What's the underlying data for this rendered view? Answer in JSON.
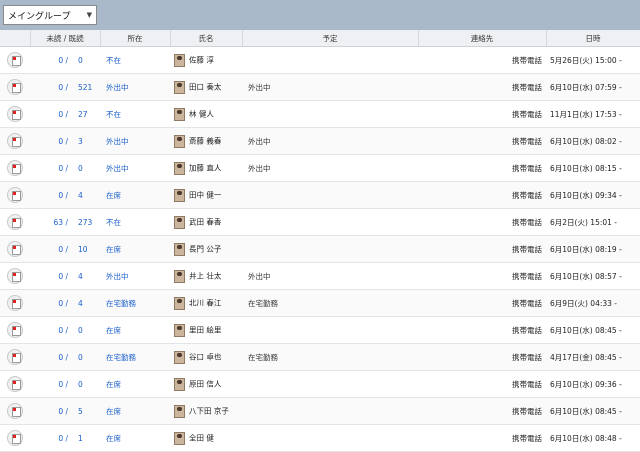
{
  "group_select": {
    "value": "メイングループ"
  },
  "headers": {
    "unread_read": "未読 / 既読",
    "location": "所在",
    "name": "氏名",
    "schedule": "予定",
    "contact": "連絡先",
    "datetime": "日時"
  },
  "rows": [
    {
      "unread": "0 /",
      "read": "0",
      "status": "不在",
      "name": "佐藤 淳",
      "schedule": "",
      "contact": "携帯電話",
      "datetime": "5月26日(火) 15:00 -"
    },
    {
      "unread": "0 /",
      "read": "521",
      "status": "外出中",
      "name": "田口 奏太",
      "schedule": "外出中",
      "contact": "携帯電話",
      "datetime": "6月10日(水) 07:59 -"
    },
    {
      "unread": "0 /",
      "read": "27",
      "status": "不在",
      "name": "林 健人",
      "schedule": "",
      "contact": "携帯電話",
      "datetime": "11月1日(水) 17:53 -"
    },
    {
      "unread": "0 /",
      "read": "3",
      "status": "外出中",
      "name": "斎藤 義春",
      "schedule": "外出中",
      "contact": "携帯電話",
      "datetime": "6月10日(水) 08:02 -"
    },
    {
      "unread": "0 /",
      "read": "0",
      "status": "外出中",
      "name": "加藤 直人",
      "schedule": "外出中",
      "contact": "携帯電話",
      "datetime": "6月10日(水) 08:15 -"
    },
    {
      "unread": "0 /",
      "read": "4",
      "status": "在席",
      "name": "田中 健一",
      "schedule": "",
      "contact": "携帯電話",
      "datetime": "6月10日(水) 09:34 -"
    },
    {
      "unread": "63 /",
      "read": "273",
      "status": "不在",
      "name": "武田 春香",
      "schedule": "",
      "contact": "携帯電話",
      "datetime": "6月2日(火) 15:01 -"
    },
    {
      "unread": "0 /",
      "read": "10",
      "status": "在席",
      "name": "長門 公子",
      "schedule": "",
      "contact": "携帯電話",
      "datetime": "6月10日(水) 08:19 -"
    },
    {
      "unread": "0 /",
      "read": "4",
      "status": "外出中",
      "name": "井上 壮太",
      "schedule": "外出中",
      "contact": "携帯電話",
      "datetime": "6月10日(水) 08:57 -"
    },
    {
      "unread": "0 /",
      "read": "4",
      "status": "在宅勤務",
      "name": "北川 春江",
      "schedule": "在宅勤務",
      "contact": "携帯電話",
      "datetime": "6月9日(火) 04:33 -"
    },
    {
      "unread": "0 /",
      "read": "0",
      "status": "在席",
      "name": "里田 絵里",
      "schedule": "",
      "contact": "携帯電話",
      "datetime": "6月10日(水) 08:45 -"
    },
    {
      "unread": "0 /",
      "read": "0",
      "status": "在宅勤務",
      "name": "谷口 卓也",
      "schedule": "在宅勤務",
      "contact": "携帯電話",
      "datetime": "4月17日(金) 08:45 -"
    },
    {
      "unread": "0 /",
      "read": "0",
      "status": "在席",
      "name": "原田 信人",
      "schedule": "",
      "contact": "携帯電話",
      "datetime": "6月10日(水) 09:36 -"
    },
    {
      "unread": "0 /",
      "read": "5",
      "status": "在席",
      "name": "八下田 京子",
      "schedule": "",
      "contact": "携帯電話",
      "datetime": "6月10日(水) 08:45 -"
    },
    {
      "unread": "0 /",
      "read": "1",
      "status": "在席",
      "name": "全田 健",
      "schedule": "",
      "contact": "携帯電話",
      "datetime": "6月10日(水) 08:48 -"
    }
  ]
}
